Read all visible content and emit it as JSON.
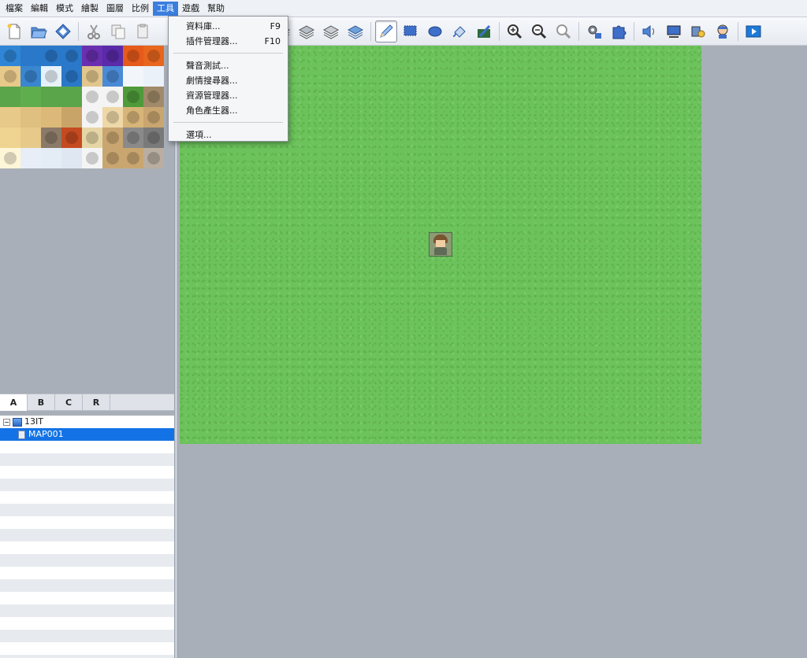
{
  "menubar": {
    "items": [
      {
        "label": "檔案"
      },
      {
        "label": "編輯"
      },
      {
        "label": "模式"
      },
      {
        "label": "繪製"
      },
      {
        "label": "圖層"
      },
      {
        "label": "比例"
      },
      {
        "label": "工具"
      },
      {
        "label": "遊戲"
      },
      {
        "label": "幫助"
      }
    ],
    "active_index": 6
  },
  "tools_menu": {
    "database": {
      "label": "資料庫...",
      "shortcut": "F9"
    },
    "plugin_manager": {
      "label": "插件管理器...",
      "shortcut": "F10"
    },
    "sound_test": {
      "label": "聲音測試..."
    },
    "event_searcher": {
      "label": "劇情搜尋器..."
    },
    "resource_manager": {
      "label": "資源管理器..."
    },
    "character_generator": {
      "label": "角色產生器..."
    },
    "options": {
      "label": "選項..."
    }
  },
  "tileset_tabs": {
    "items": [
      {
        "label": "A"
      },
      {
        "label": "B"
      },
      {
        "label": "C"
      },
      {
        "label": "R"
      }
    ],
    "active_index": 0
  },
  "map_tree": {
    "project": "13IT",
    "maps": [
      {
        "name": "MAP001",
        "selected": true
      }
    ]
  },
  "colors": {
    "menu_highlight": "#3a7ede",
    "tree_selection": "#1373e6",
    "map_grass": "#6cc35c",
    "workspace_bg": "#a9afb8"
  }
}
